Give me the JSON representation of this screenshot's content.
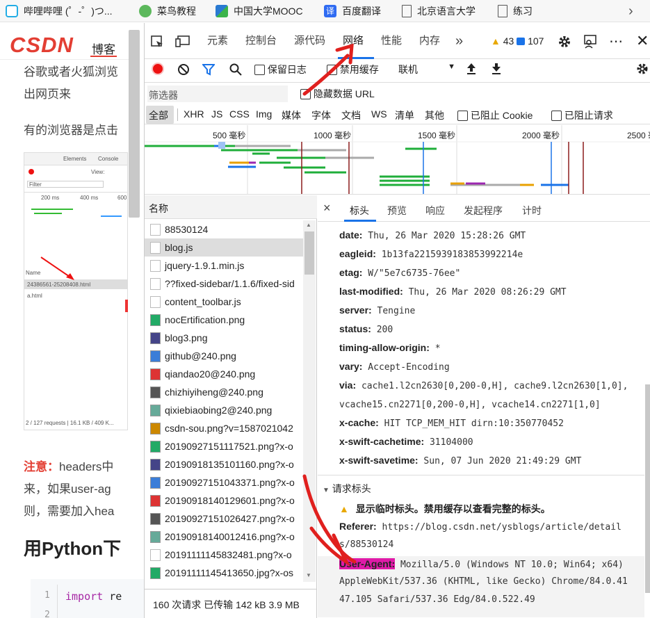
{
  "bookmarks": [
    {
      "label": "哔哩哔哩 (゜-゜)つ...",
      "color": "#23ade5"
    },
    {
      "label": "菜鸟教程",
      "color": "#5cb85c"
    },
    {
      "label": "中国大学MOOC",
      "color": "#2a7ad2"
    },
    {
      "label": "百度翻译",
      "color": "#2f6bf2"
    },
    {
      "label": "北京语言大学",
      "color": "#777777"
    },
    {
      "label": "练习",
      "color": "#777777"
    }
  ],
  "page": {
    "logo": "CSDN",
    "nav_blog": "博客",
    "line1": "谷歌或者火狐浏览",
    "line2": "出网页来",
    "line3": "有的浏览器是点击",
    "thumb": {
      "tab_elements": "Elements",
      "tab_console": "Console",
      "view": "View:",
      "filter": "Filter",
      "ticks": [
        "200 ms",
        "400 ms",
        "600"
      ],
      "name": "Name",
      "file1": "24386561-25208408.html",
      "file2": "a.html",
      "status": "2 / 127 requests | 16.1 KB / 409 K..."
    },
    "note_label": "注意：",
    "note_text": "headers中",
    "line5": "来，如果user-ag",
    "line6": "则，需要加入hea",
    "heading": "用Python下",
    "code_lines": [
      "1",
      "2"
    ],
    "code_import": "import",
    "code_rest": "re"
  },
  "devtools": {
    "tabs": [
      "元素",
      "控制台",
      "源代码",
      "网络",
      "性能",
      "内存"
    ],
    "more": "»",
    "warn_count": "43",
    "msg_count": "107",
    "preserve_log": "保留日志",
    "disable_cache": "禁用缓存",
    "throttle": "联机",
    "filter_placeholder": "筛选器",
    "hide_data_url": "隐藏数据 URL",
    "types": [
      "全部",
      "XHR",
      "JS",
      "CSS",
      "Img",
      "媒体",
      "字体",
      "文档",
      "WS",
      "清单",
      "其他"
    ],
    "blocked_cookies": "已阻止 Cookie",
    "blocked_requests": "已阻止请求",
    "timeline_ticks": [
      "500 毫秒",
      "1000 毫秒",
      "1500 毫秒",
      "2000 毫秒",
      "2500 毫"
    ],
    "name_header": "名称",
    "files": [
      {
        "name": "88530124",
        "icon": "doc"
      },
      {
        "name": "blog.js",
        "icon": "doc"
      },
      {
        "name": "jquery-1.9.1.min.js",
        "icon": "doc"
      },
      {
        "name": "??fixed-sidebar/1.1.6/fixed-sid",
        "icon": "doc"
      },
      {
        "name": "content_toolbar.js",
        "icon": "doc"
      },
      {
        "name": "nocErtification.png",
        "icon": "img"
      },
      {
        "name": "blog3.png",
        "icon": "img"
      },
      {
        "name": "github@240.png",
        "icon": "img"
      },
      {
        "name": "qiandao20@240.png",
        "icon": "img"
      },
      {
        "name": "chizhiyiheng@240.png",
        "icon": "img"
      },
      {
        "name": "qixiebiaobing2@240.png",
        "icon": "img"
      },
      {
        "name": "csdn-sou.png?v=1587021042",
        "icon": "img"
      },
      {
        "name": "20190927151117521.png?x-o",
        "icon": "img"
      },
      {
        "name": "20190918135101160.png?x-o",
        "icon": "img"
      },
      {
        "name": "20190927151043371.png?x-o",
        "icon": "img"
      },
      {
        "name": "20190918140129601.png?x-o",
        "icon": "img"
      },
      {
        "name": "20190927151026427.png?x-o",
        "icon": "img"
      },
      {
        "name": "20190918140012416.png?x-o",
        "icon": "img"
      },
      {
        "name": "20191111145832481.png?x-o",
        "icon": "doc"
      },
      {
        "name": "20191111145413650.jpg?x-os",
        "icon": "img"
      }
    ],
    "summary": "160 次请求  已传输 142 kB  3.9 MB",
    "detail_close": "×",
    "detail_tabs": [
      "标头",
      "预览",
      "响应",
      "发起程序",
      "计时"
    ],
    "headers": [
      {
        "k": "date:",
        "v": "Thu, 26 Mar 2020 15:28:26 GMT"
      },
      {
        "k": "eagleid:",
        "v": "1b13fa2215939183853992214e"
      },
      {
        "k": "etag:",
        "v": "W/\"5e7c6735-76ee\""
      },
      {
        "k": "last-modified:",
        "v": "Thu, 26 Mar 2020 08:26:29 GMT"
      },
      {
        "k": "server:",
        "v": "Tengine"
      },
      {
        "k": "status:",
        "v": "200"
      },
      {
        "k": "timing-allow-origin:",
        "v": "*"
      },
      {
        "k": "vary:",
        "v": "Accept-Encoding"
      },
      {
        "k": "via:",
        "v": "cache1.l2cn2630[0,200-0,H], cache9.l2cn2630[1,0],"
      },
      {
        "k": "",
        "v": "vcache15.cn2271[0,200-0,H], vcache14.cn2271[1,0]"
      },
      {
        "k": "x-cache:",
        "v": "HIT TCP_MEM_HIT dirn:10:350770452"
      },
      {
        "k": "x-swift-cachetime:",
        "v": "31104000"
      },
      {
        "k": "x-swift-savetime:",
        "v": "Sun, 07 Jun 2020 21:49:29 GMT"
      }
    ],
    "request_headers_title": "请求标头",
    "provisional_warning": "显示临时标头。禁用缓存以查看完整的标头。",
    "referer_key": "Referer:",
    "referer_val1": "https://blog.csdn.net/ysblogs/article/detail",
    "referer_val2": "s/88530124",
    "ua_key": "User-Agent:",
    "ua_val1": "Mozilla/5.0 (Windows NT 10.0; Win64; x64)",
    "ua_val2": "AppleWebKit/537.36 (KHTML, like Gecko) Chrome/84.0.41",
    "ua_val3": "47.105 Safari/537.36 Edg/84.0.522.49"
  },
  "colors": {
    "accent": "#1a73e8",
    "record": "#e11",
    "annotation": "#e0201e",
    "highlight": "#e01aa8"
  }
}
